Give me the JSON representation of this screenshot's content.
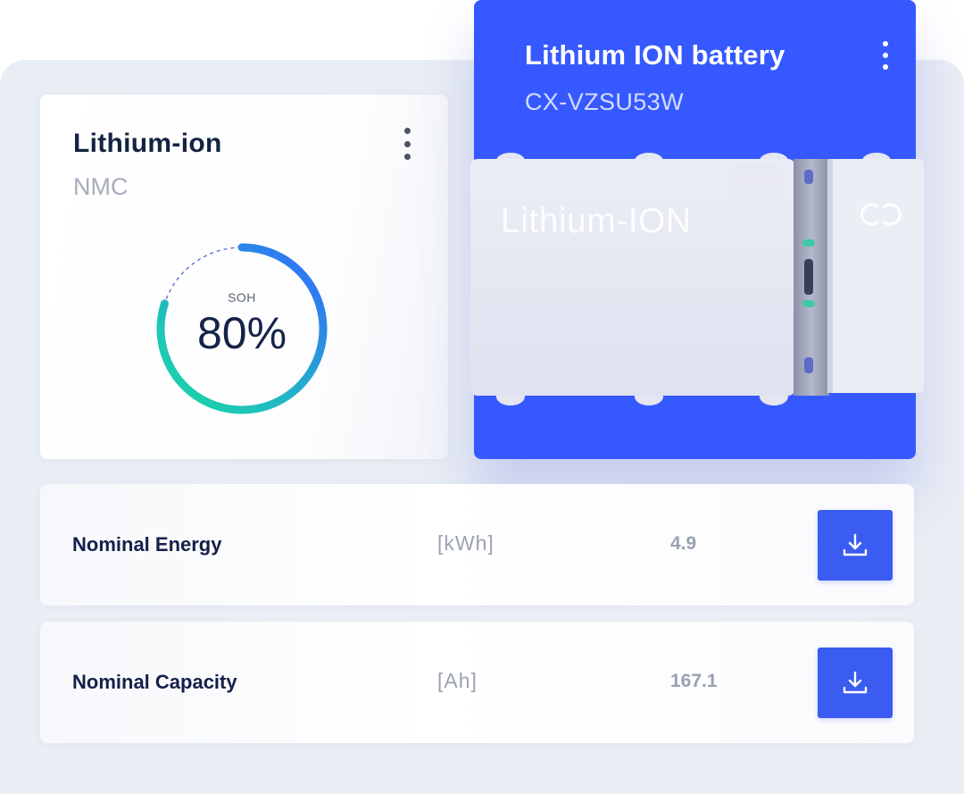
{
  "soh_card": {
    "title": "Lithium-ion",
    "subtitle": "NMC",
    "gauge": {
      "label": "SOH",
      "value_text": "80%",
      "fraction": 0.8
    },
    "menu_icon": "vertical-dots-icon"
  },
  "battery_card": {
    "title": "Lithium ION battery",
    "serial": "CX-VZSU53W",
    "module_label": "Lithium-ION",
    "menu_icon": "vertical-dots-icon",
    "brand_mark_icon": "infinity-link-icon"
  },
  "specs": [
    {
      "name": "Nominal Energy",
      "unit": "[kWh]",
      "value": "4.9",
      "action_icon": "download-icon"
    },
    {
      "name": "Nominal Capacity",
      "unit": "[Ah]",
      "value": "167.1",
      "action_icon": "download-icon"
    }
  ],
  "colors": {
    "accent_blue": "#3659ff",
    "button_blue": "#3a5cf0",
    "gauge_gradient_start": "#19dba2",
    "gauge_gradient_end": "#3366ff",
    "heading": "#142341",
    "muted_text": "#a7adbb",
    "backdrop": "#e9edf4"
  }
}
